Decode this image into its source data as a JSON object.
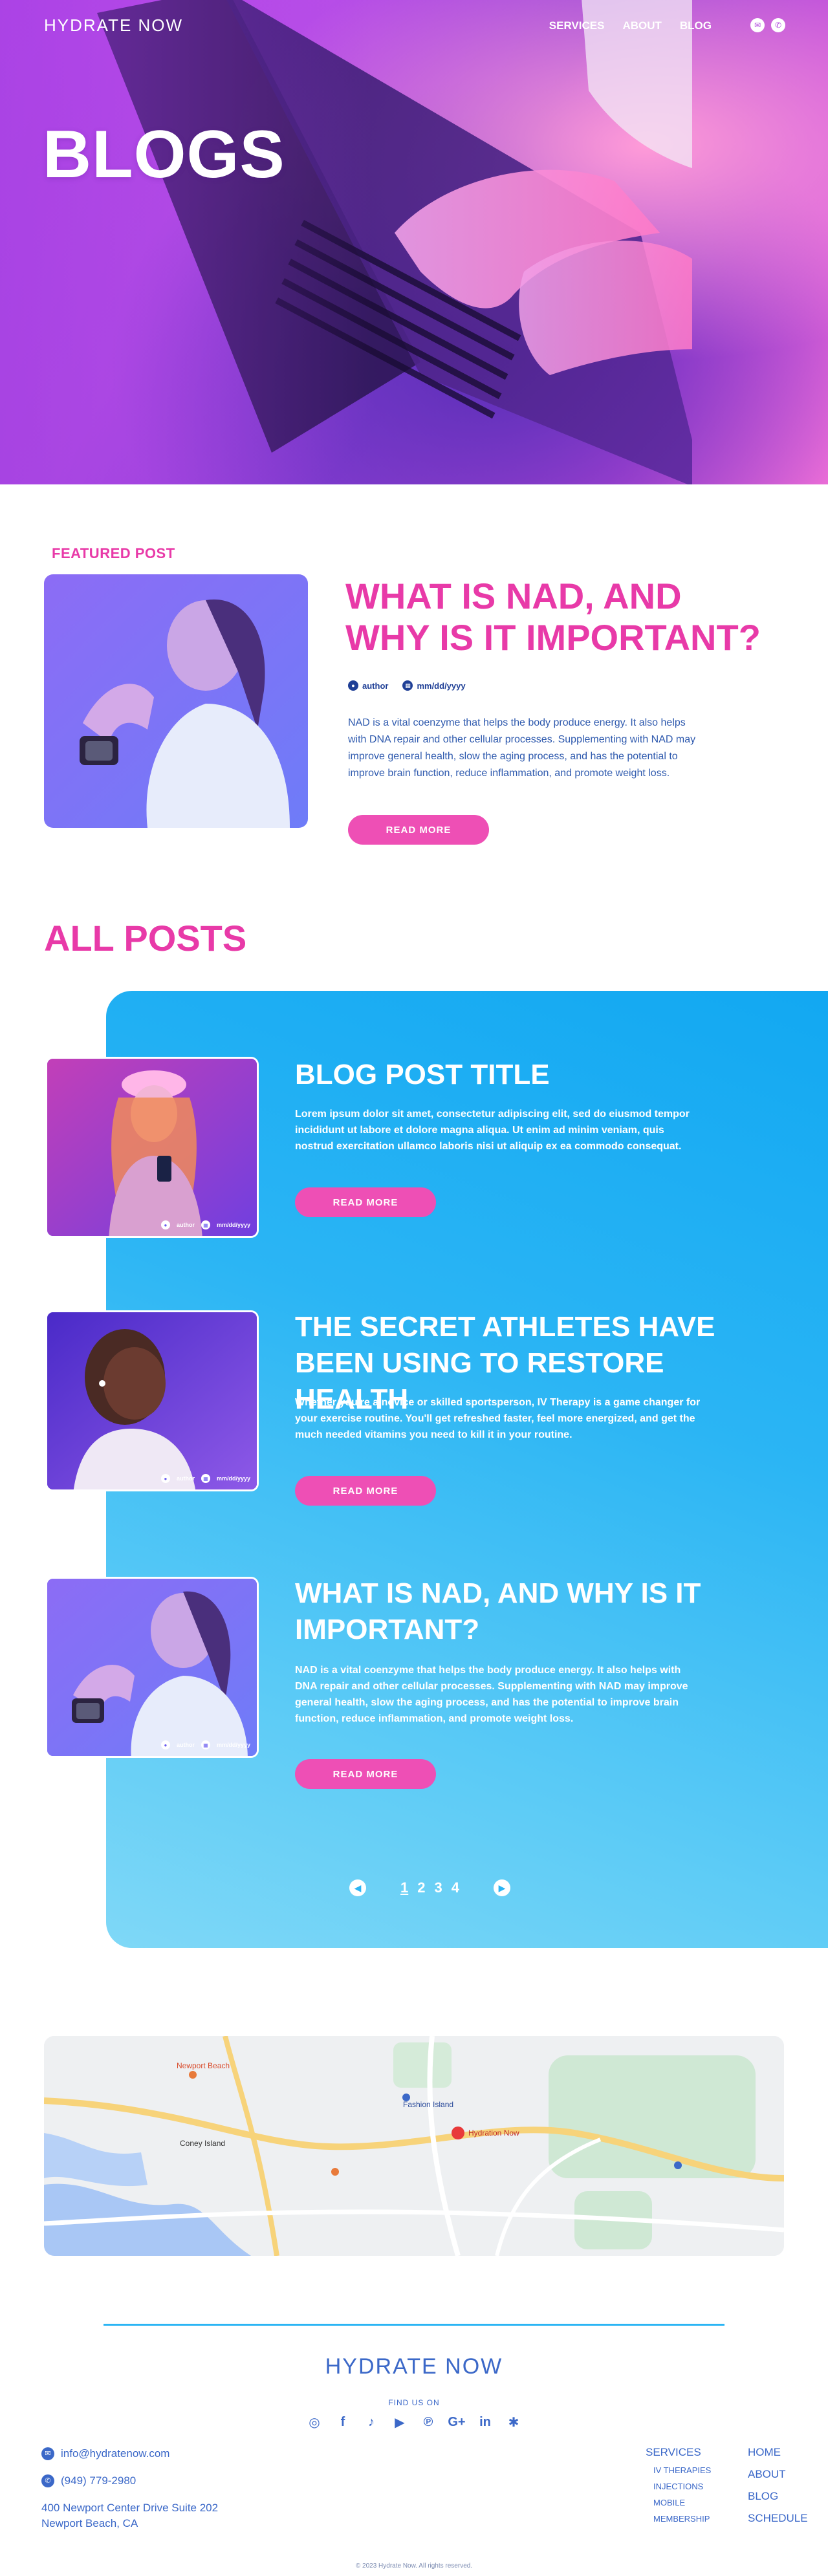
{
  "header": {
    "logo": "HYDRATE NOW",
    "nav": [
      "SERVICES",
      "ABOUT",
      "BLOG"
    ]
  },
  "hero": {
    "title": "BLOGS"
  },
  "featured": {
    "label": "FEATURED POST",
    "title": "WHAT IS NAD, AND WHY IS IT IMPORTANT?",
    "author": "author",
    "date": "mm/dd/yyyy",
    "text": "NAD is a vital coenzyme that helps the body produce energy. It also helps with DNA repair and other cellular processes. Supplementing with NAD may improve general health, slow the aging process, and has the potential to improve brain function, reduce inflammation, and promote weight loss.",
    "button": "READ MORE"
  },
  "all_posts": {
    "title": "ALL POSTS",
    "posts": [
      {
        "title": "BLOG POST TITLE",
        "text": "Lorem ipsum dolor sit amet, consectetur adipiscing elit, sed do eiusmod tempor incididunt ut labore et dolore magna aliqua. Ut enim ad minim veniam, quis nostrud exercitation ullamco laboris nisi ut aliquip ex ea commodo consequat.",
        "author": "author",
        "date": "mm/dd/yyyy",
        "button": "READ MORE"
      },
      {
        "title": "THE SECRET ATHLETES HAVE BEEN USING TO RESTORE HEALTH",
        "text": "Whether you're a novice or skilled sportsperson, IV Therapy is a game changer for your exercise routine. You'll get refreshed faster, feel more energized, and get the much needed vitamins you need to kill it in your routine.",
        "author": "author",
        "date": "mm/dd/yyyy",
        "button": "READ MORE"
      },
      {
        "title": "WHAT IS NAD, AND WHY IS IT IMPORTANT?",
        "text": "NAD is a vital coenzyme that helps the body produce energy. It also helps with DNA repair and other cellular processes. Supplementing with NAD may improve general health, slow the aging process, and has the potential to improve brain function, reduce inflammation, and promote weight loss.",
        "author": "author",
        "date": "mm/dd/yyyy",
        "button": "READ MORE"
      }
    ],
    "pagination": [
      "1",
      "2",
      "3",
      "4"
    ]
  },
  "map": {
    "labels": [
      "Newport Beach",
      "Coney Island",
      "Fashion Island",
      "Hydration Now"
    ]
  },
  "footer": {
    "logo": "HYDRATE NOW",
    "find_us": "FIND US ON",
    "email": "info@hydratenow.com",
    "phone": "(949) 779-2980",
    "address_line1": "400 Newport Center Drive Suite 202",
    "address_line2": "Newport Beach, CA",
    "services_heading": "SERVICES",
    "services": [
      "IV THERAPIES",
      "INJECTIONS",
      "MOBILE",
      "MEMBERSHIP"
    ],
    "links": [
      "HOME",
      "ABOUT",
      "BLOG",
      "SCHEDULE"
    ],
    "copyright": "© 2023 Hydrate Now. All rights reserved."
  },
  "colors": {
    "accent_pink": "#e83aa8",
    "accent_blue": "#2bb5f4",
    "text_blue": "#3b68c8"
  }
}
